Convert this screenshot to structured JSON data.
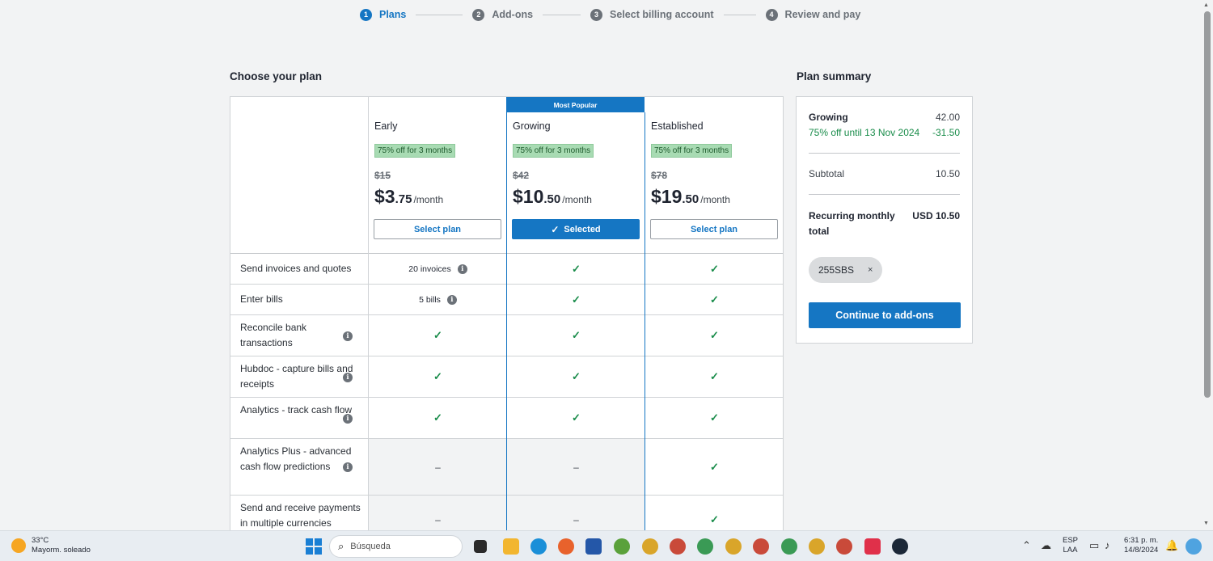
{
  "stepper": {
    "steps": [
      {
        "num": "1",
        "label": "Plans"
      },
      {
        "num": "2",
        "label": "Add-ons"
      },
      {
        "num": "3",
        "label": "Select billing account"
      },
      {
        "num": "4",
        "label": "Review and pay"
      }
    ]
  },
  "plans_section": {
    "title": "Choose your plan",
    "most_popular": "Most Popular",
    "plans": [
      {
        "name": "Early",
        "promo": "75% off for 3 months",
        "old_price": "$15",
        "price_main": "$3",
        "price_cents": ".75",
        "per": "/month",
        "button": "Select plan"
      },
      {
        "name": "Growing",
        "promo": "75% off for 3 months",
        "old_price": "$42",
        "price_main": "$10",
        "price_cents": ".50",
        "per": "/month",
        "button": "Selected"
      },
      {
        "name": "Established",
        "promo": "75% off for 3 months",
        "old_price": "$78",
        "price_main": "$19",
        "price_cents": ".50",
        "per": "/month",
        "button": "Select plan"
      }
    ],
    "features": [
      {
        "label": "Send invoices and quotes",
        "early": "20 invoices",
        "growing": "check",
        "established": "check"
      },
      {
        "label": "Enter bills",
        "early": "5 bills",
        "growing": "check",
        "established": "check"
      },
      {
        "label": "Reconcile bank transactions",
        "early": "check",
        "growing": "check",
        "established": "check"
      },
      {
        "label": "Hubdoc - capture bills and receipts",
        "early": "check",
        "growing": "check",
        "established": "check"
      },
      {
        "label": "Analytics - track cash flow",
        "early": "check",
        "growing": "check",
        "established": "check"
      },
      {
        "label": "Analytics Plus - advanced cash flow predictions",
        "early": "dash",
        "growing": "dash",
        "established": "check"
      },
      {
        "label": "Send and receive payments in multiple currencies",
        "early": "dash",
        "growing": "dash",
        "established": "check"
      }
    ],
    "check_glyph": "✓",
    "dash_glyph": "–"
  },
  "summary": {
    "title": "Plan summary",
    "plan_name": "Growing",
    "plan_amount": "42.00",
    "discount_label": "75% off until 13 Nov 2024",
    "discount_amount": "-31.50",
    "subtotal_label": "Subtotal",
    "subtotal_amount": "10.50",
    "recurring_label_1": "Recurring monthly",
    "recurring_label_2": "total",
    "recurring_amount": "USD 10.50",
    "promo_code": "255SBS",
    "promo_remove": "×",
    "continue_button": "Continue to add-ons"
  },
  "taskbar": {
    "weather_temp": "33°C",
    "weather_desc": "Mayorm. soleado",
    "search_placeholder": "Búsqueda",
    "lang_1": "ESP",
    "lang_2": "LAA",
    "time": "6:31 p. m.",
    "date": "14/8/2024"
  },
  "colors": {
    "accent": "#1576c3",
    "success": "#198c4a",
    "promo_bg": "#a8dbb3"
  }
}
